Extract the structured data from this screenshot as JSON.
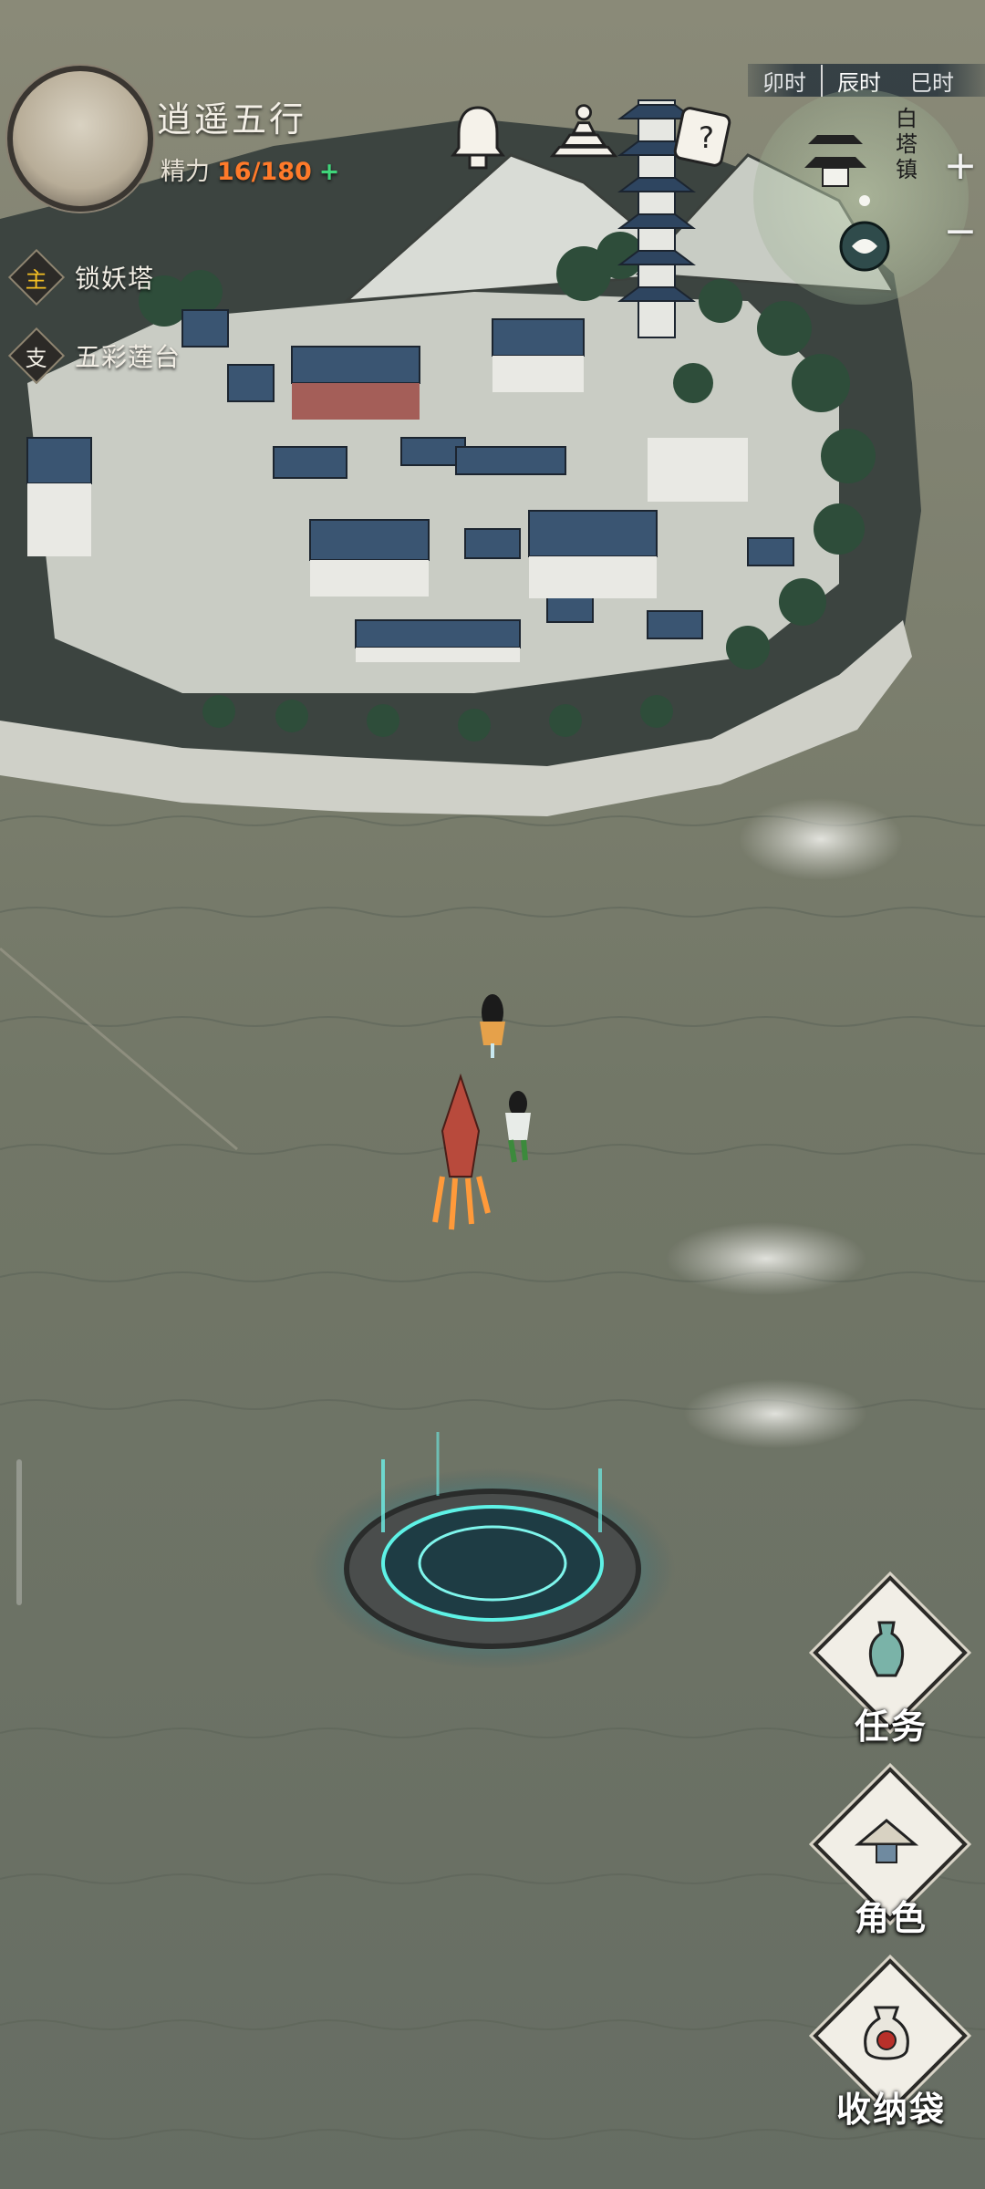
{
  "player": {
    "name": "逍遥五行",
    "stamina_label": "精力",
    "stamina_value": "16/180",
    "stamina_add": "+"
  },
  "top_icons": [
    "bell-icon",
    "tower-icon",
    "quest-scroll-icon"
  ],
  "time_bar": {
    "items": [
      "卯时",
      "辰时",
      "巳时"
    ],
    "active_index": 1
  },
  "minimap": {
    "location": "白塔镇",
    "location_chars": [
      "白",
      "塔",
      "镇"
    ],
    "zoom_in": "+",
    "zoom_out": "−"
  },
  "quests": {
    "main": {
      "tag": "主",
      "title": "锁妖塔"
    },
    "side": {
      "tag": "支",
      "title": "五彩莲台"
    }
  },
  "side_buttons": {
    "tasks": "任务",
    "character": "角色",
    "bag": "收纳袋"
  },
  "colors": {
    "water": "#6f7468",
    "accent_orange": "#ff7a2a",
    "accent_green": "#3fd67a",
    "portal_glow": "#43e0d8",
    "roof_blue": "#2f4660"
  }
}
